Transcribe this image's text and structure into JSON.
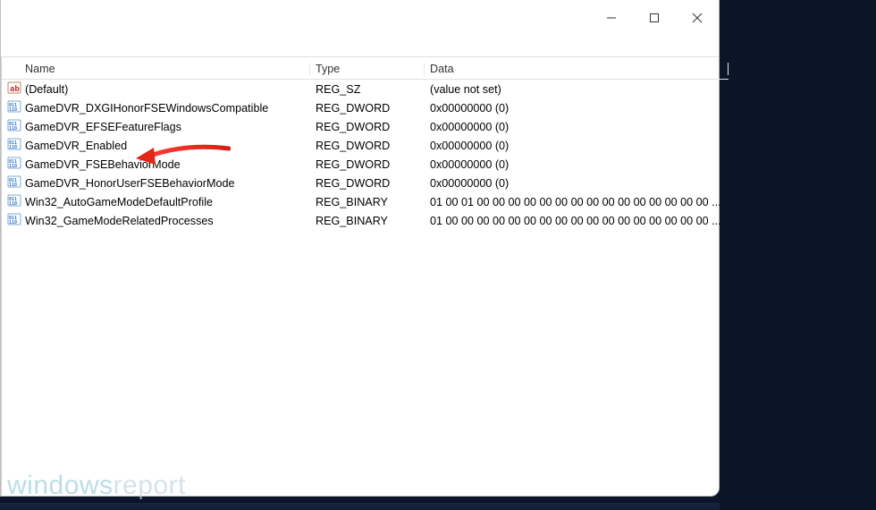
{
  "titlebar": {
    "minimize_tip": "Minimize",
    "maximize_tip": "Maximize",
    "close_tip": "Close"
  },
  "columns": {
    "name": "Name",
    "type": "Type",
    "data": "Data"
  },
  "values": [
    {
      "icon": "sz",
      "name": "(Default)",
      "type": "REG_SZ",
      "data": "(value not set)"
    },
    {
      "icon": "bin",
      "name": "GameDVR_DXGIHonorFSEWindowsCompatible",
      "type": "REG_DWORD",
      "data": "0x00000000 (0)"
    },
    {
      "icon": "bin",
      "name": "GameDVR_EFSEFeatureFlags",
      "type": "REG_DWORD",
      "data": "0x00000000 (0)"
    },
    {
      "icon": "bin",
      "name": "GameDVR_Enabled",
      "type": "REG_DWORD",
      "data": "0x00000000 (0)"
    },
    {
      "icon": "bin",
      "name": "GameDVR_FSEBehaviorMode",
      "type": "REG_DWORD",
      "data": "0x00000000 (0)"
    },
    {
      "icon": "bin",
      "name": "GameDVR_HonorUserFSEBehaviorMode",
      "type": "REG_DWORD",
      "data": "0x00000000 (0)"
    },
    {
      "icon": "bin",
      "name": "Win32_AutoGameModeDefaultProfile",
      "type": "REG_BINARY",
      "data": "01 00 01 00 00 00 00 00 00 00 00 00 00 00 00 00 00 00 ..."
    },
    {
      "icon": "bin",
      "name": "Win32_GameModeRelatedProcesses",
      "type": "REG_BINARY",
      "data": "01 00 00 00 00 00 00 00 00 00 00 00 00 00 00 00 00 00 ..."
    }
  ],
  "annotation": {
    "target_value": "GameDVR_Enabled"
  },
  "watermark": {
    "text1": "windows",
    "text2": "report"
  }
}
